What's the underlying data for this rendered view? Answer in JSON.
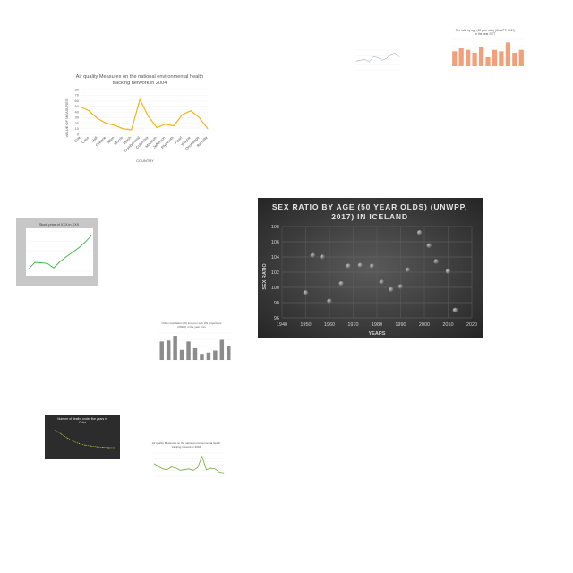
{
  "chart_data": [
    {
      "type": "line",
      "title": "Air quality Measures on the national environmental health tracking network in 2004",
      "xlabel": "COUNTRY",
      "ylabel": "VALUE OF MEASURES",
      "categories": [
        "Erie",
        "Cass",
        "Hall",
        "Greene",
        "Allen",
        "Morris",
        "Wash",
        "Cumberland",
        "Columbia",
        "Madison",
        "Jefferson",
        "Plymouth",
        "Pearl",
        "Wayne",
        "Onondaga",
        "Renville"
      ],
      "values": [
        49,
        42,
        28,
        20,
        16,
        10,
        8,
        62,
        32,
        12,
        18,
        15,
        35,
        42,
        30,
        10
      ],
      "ylim": [
        0,
        80
      ],
      "yticks": [
        "0",
        "10",
        "20",
        "30",
        "40",
        "50",
        "60",
        "70",
        "80"
      ],
      "color": "#f3b31b"
    },
    {
      "type": "line",
      "title": "Stock price of XXX in XXX",
      "xlabel": "",
      "ylabel": "",
      "values": [
        1,
        4,
        3.8,
        3.5,
        1.5,
        4.3,
        6.5,
        8.5,
        10.5,
        13,
        16
      ],
      "ylim": [
        0,
        18
      ],
      "color": "#3cb44b"
    },
    {
      "type": "bar",
      "title": "Urban population (%) long-run with UN projections (OWID) in the year xxxx",
      "xlabel": "",
      "ylabel": "",
      "values": [
        55,
        58,
        72,
        30,
        55,
        35,
        18,
        22,
        28,
        60,
        40
      ],
      "ylim": [
        0,
        80
      ],
      "color": "#8c8c8c"
    },
    {
      "type": "line",
      "title": "Number of deaths under five years in Cuba",
      "values": [
        30,
        25,
        20,
        16,
        13,
        11,
        10,
        9,
        8.5,
        8,
        8
      ],
      "ylim": [
        0,
        34
      ],
      "color": "#c8d841"
    },
    {
      "type": "line",
      "title": "Air quality Measures on the national environmental health tracking network in 2004",
      "values": [
        38,
        30,
        22,
        20,
        28,
        25,
        18,
        20,
        22,
        18,
        26,
        60,
        20,
        24,
        22,
        12,
        10
      ],
      "ylim": [
        0,
        70
      ],
      "color": "#7aa83b"
    },
    {
      "type": "line",
      "title": "",
      "values": [
        20,
        22,
        24,
        18,
        30,
        28,
        22,
        26,
        35,
        38,
        30
      ],
      "ylim": [
        0,
        45
      ],
      "color": "#9aa3ad"
    },
    {
      "type": "bar",
      "title": "Sex ratio by age (60 year olds) (UNWPP, 2017) in the year 2077",
      "values": [
        100,
        102,
        101,
        99,
        103,
        96,
        101,
        100,
        106,
        99,
        101
      ],
      "ylim": [
        90,
        108
      ],
      "color": "#f0a07a"
    },
    {
      "type": "scatter",
      "title": "SEX RATIO BY AGE (50 YEAR OLDS) (UNWPP, 2017) IN ICELAND",
      "xlabel": "YEARS",
      "ylabel": "SEX RATIO",
      "x": [
        1950,
        1953,
        1957,
        1960,
        1965,
        1968,
        1973,
        1978,
        1982,
        1986,
        1990,
        1993,
        1998,
        2002,
        2005,
        2010,
        2013
      ],
      "y": [
        99.3,
        104.2,
        104.0,
        98.2,
        100.5,
        102.8,
        102.9,
        102.8,
        100.7,
        99.7,
        100.1,
        102.3,
        107.2,
        105.5,
        103.4,
        102.1,
        97.0
      ],
      "xlim": [
        1940,
        2020
      ],
      "ylim": [
        96,
        108
      ],
      "xticks": [
        "1940",
        "1950",
        "1960",
        "1970",
        "1980",
        "1990",
        "2000",
        "2010",
        "2020"
      ],
      "yticks": [
        "96",
        "98",
        "100",
        "102",
        "104",
        "106",
        "108"
      ],
      "grid": true
    }
  ]
}
